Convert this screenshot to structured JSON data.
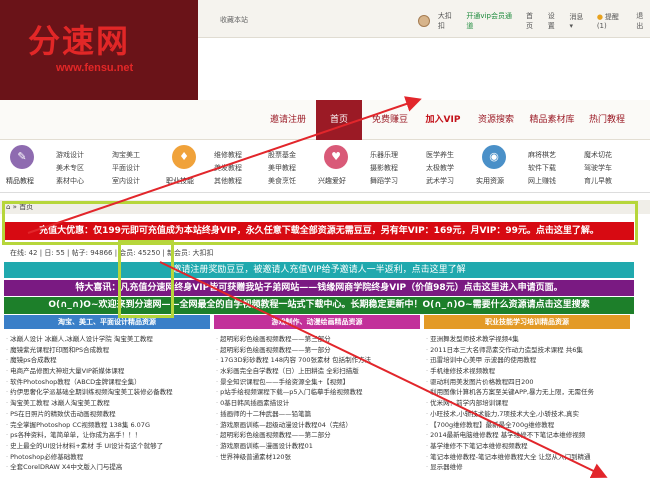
{
  "topbar": {
    "favorite": "收藏本站",
    "username": "大扣扣",
    "vip_link": "开通vip会员通道",
    "links": [
      "首页",
      "设置",
      "消息 ▾",
      "提醒(1)",
      "退出"
    ]
  },
  "logo": {
    "text": "分速网",
    "url": "www.fensu.net"
  },
  "nav": [
    {
      "label": "邀请注册"
    },
    {
      "label": "首页"
    },
    {
      "label": "免费赚豆"
    },
    {
      "label": "加入VIP"
    },
    {
      "label": "资源搜索"
    },
    {
      "label": "精品素材库"
    },
    {
      "label": "热门教程"
    }
  ],
  "categories": [
    {
      "label": "精品教程",
      "icon": "book-icon",
      "color": "#8e6bb0",
      "links": [
        "游戏设计",
        "美术专区",
        "素材中心"
      ]
    },
    {
      "label": "",
      "icon": "",
      "color": "",
      "links": [
        "淘宝美工",
        "平面设计",
        "室内设计"
      ]
    },
    {
      "label": "职业技能",
      "icon": "briefcase-icon",
      "color": "#f0a23a",
      "links": [
        "维修教程",
        "美发教程",
        "其他教程"
      ]
    },
    {
      "label": "兴趣爱好",
      "icon": "heart-icon",
      "color": "#d95a78",
      "links": [
        "股票基金",
        "美甲教程",
        "美食烹饪"
      ]
    },
    {
      "label": "实用资源",
      "icon": "globe-icon",
      "color": "#4a90c8",
      "links": [
        "乐器乐理",
        "摄影教程",
        "舞蹈学习"
      ]
    },
    {
      "label": "",
      "icon": "",
      "color": "",
      "links": [
        "医学养生",
        "太极教学",
        "武术学习"
      ]
    },
    {
      "label": "",
      "icon": "",
      "color": "",
      "links": [
        "麻将棋艺",
        "软件下载",
        "网上赚钱"
      ]
    },
    {
      "label": "",
      "icon": "",
      "color": "",
      "links": [
        "魔术切花",
        "驾驶学车",
        "育儿早教"
      ]
    }
  ],
  "breadcrumb": "首页",
  "banners": {
    "red": "充值大优惠：仅199元即可充值成为本站终身VIP，永久任意下载全部资源无需豆豆，另有年VIP：169元，月VIP：99元。点击这里了解。",
    "stats": [
      "在线: 42",
      "日: 55",
      "帖子: 94866",
      "会员: 45250",
      "新会员: 大扣扣"
    ],
    "teal": "邀请注册奖励豆豆，被邀请人充值VIP给予邀请人一半返利，点击这里了解",
    "purple": "特大喜讯：凡充值分速网终身VIP皆可获赠我站子弟网站——钱缘网商学院终身VIP（价值98元）点击这里进入申请页面。",
    "green": "O(∩_∩)O~欢迎来到分速网——全网最全的自学视频教程一站式下载中心。长期稳定更新中！O(∩_∩)O~需要什么资源请点击这里搜索"
  },
  "columns": [
    {
      "title": "淘宝、美工、平面设计精品资源",
      "color": "#3a7fc8",
      "items": [
        "冰巅人设计 冰巅人,冰巅人设计学院 淘宝美工教程",
        "魔镜紫光课程打印图和PS合成教程",
        "魔镜ps合成教程",
        "电商产品修图大神班大量VIP新媒体课程",
        "软件Photoshop教程（ABCD金牌课程全集）",
        "约伊思奢化学派基础全期训练视频淘宝美工装修必备教程",
        "淘宝美工教程 冰巅人淘宝美工教程",
        "PS在日照片的精致伏击动画视频教程",
        "完全掌握Photoshop CC视频教程 138集 6.07G",
        "ps各种资料，笔简单单，让你成为高手！！！",
        "史上最全的UI设计材料+素材 手 UI设计有这个就够了",
        "Photoshop必修基础教程",
        "全套CorelDRAW X4中文版入门与提高"
      ]
    },
    {
      "title": "游戏制作、动漫绘画精品资源",
      "color": "#c2319a",
      "items": [
        "超明彩彩色绘画视频教程——第三部分",
        "超明彩彩色绘画视频教程——第一部分",
        "17G3D彩砂教程 148内容 700张素材 包括制作方法",
        "水彩画完全自学教程（日）上田耕造 全彩扫描版",
        "景全知识课程包——手绘资源全集+【视频】",
        "p站手绘视频课程下载—p5入门临摹手绘视频教程",
        "0基日韩风插画素描设计",
        "插画师的十二种武器——铅笔篇",
        "游戏原画训练—超级动漫设计教程04（完结）",
        "超明彩彩色绘画视频教程——第二部分",
        "游戏原画训练—漫画设计教程01",
        "世界神级普通素材120张"
      ]
    },
    {
      "title": "职业技能学习培训精品资源",
      "color": "#e39a26",
      "items": [
        "亚洲舞发型师技术教学视频4集",
        "2011日本三大名师昂素交作动力造型技术课程 共6集",
        "迅雷培训中心美甲 示波器的使用教程",
        "手机维修技术视频教程",
        "驱动利用美发图片价格教程四日200",
        "利用图像计算机各方案至关键APP,暴力无上限，无需任务",
        "优米网：前学内部培训课程",
        "小旺技术,小轿技术能力,7项技术大全,小轿技术,真实",
        "【700g维修教程】最新最全700g维修教程",
        "2014最新电脑维修教程 基学维修不下笔记本维修视频",
        "基学维修不下笔记本维修视频教程",
        "笔记本维修教程-笔记本维修教程大全 让您从入门到精通",
        "显示器维修"
      ]
    }
  ]
}
